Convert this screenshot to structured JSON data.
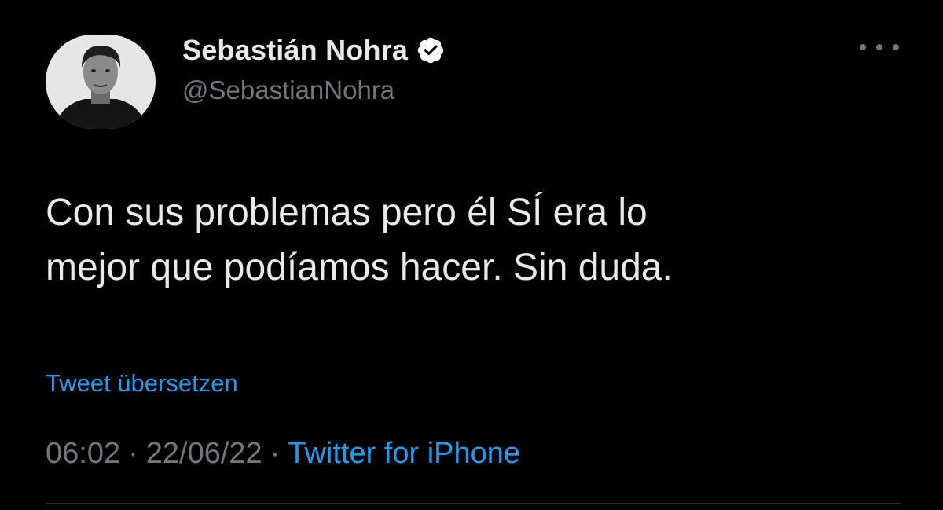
{
  "author": {
    "display_name": "Sebastián Nohra",
    "handle": "@SebastianNohra",
    "verified": true
  },
  "tweet": {
    "text": "Con sus problemas pero él SÍ era lo\nmejor que podíamos hacer. Sin duda.",
    "translate_label": "Tweet übersetzen",
    "time": "06:02",
    "date": "22/06/22",
    "source": "Twitter for iPhone",
    "separator": "·"
  },
  "icons": {
    "verified": "verified-badge-icon",
    "more": "more-options-icon"
  },
  "colors": {
    "background": "#000000",
    "primary_text": "#e7e9ea",
    "secondary_text": "#71767b",
    "link": "#1d9bf0"
  }
}
